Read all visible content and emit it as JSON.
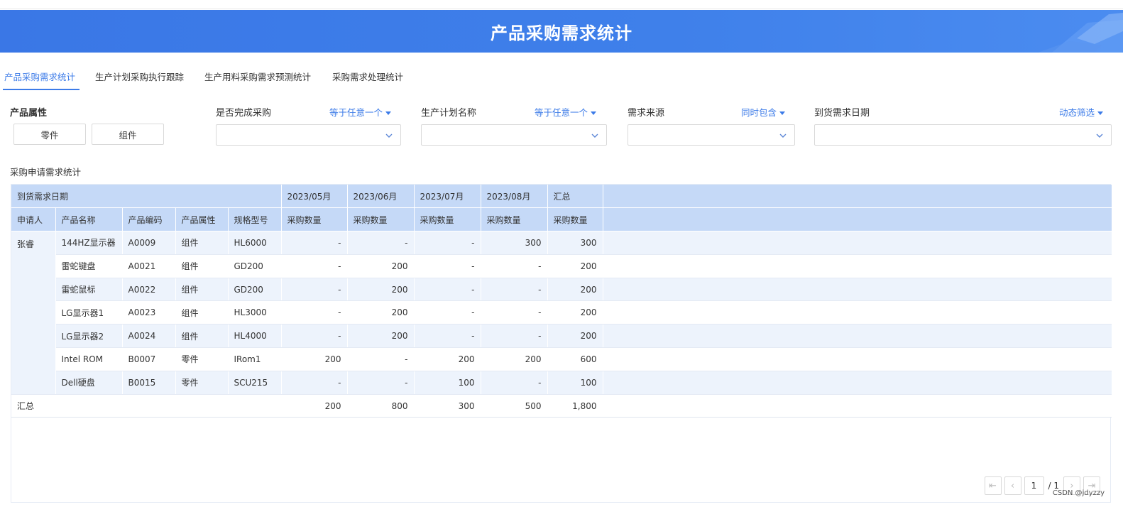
{
  "header": {
    "title": "产品采购需求统计"
  },
  "tabs": [
    {
      "label": "产品采购需求统计",
      "active": true
    },
    {
      "label": "生产计划采购执行跟踪",
      "active": false
    },
    {
      "label": "生产用料采购需求预测统计",
      "active": false
    },
    {
      "label": "采购需求处理统计",
      "active": false
    }
  ],
  "filters": {
    "product_attr": {
      "label": "产品属性",
      "options": [
        "零件",
        "组件"
      ]
    },
    "purchase_done": {
      "label": "是否完成采购",
      "operator": "等于任意一个",
      "value": ""
    },
    "plan_name": {
      "label": "生产计划名称",
      "operator": "等于任意一个",
      "value": ""
    },
    "demand_source": {
      "label": "需求来源",
      "operator": "同时包含",
      "value": ""
    },
    "arrival_date": {
      "label": "到货需求日期",
      "operator": "动态筛选",
      "value": ""
    }
  },
  "section": {
    "title": "采购申请需求统计"
  },
  "table": {
    "corner_label": "到货需求日期",
    "months": [
      "2023/05月",
      "2023/06月",
      "2023/07月",
      "2023/08月",
      "汇总"
    ],
    "columns": [
      "申请人",
      "产品名称",
      "产品编码",
      "产品属性",
      "规格型号"
    ],
    "measure": "采购数量",
    "applicant": "张睿",
    "rows": [
      {
        "name": "144HZ显示器",
        "code": "A0009",
        "attr": "组件",
        "spec": "HL6000",
        "values": [
          "-",
          "-",
          "-",
          "300",
          "300"
        ]
      },
      {
        "name": "雷蛇键盘",
        "code": "A0021",
        "attr": "组件",
        "spec": "GD200",
        "values": [
          "-",
          "200",
          "-",
          "-",
          "200"
        ]
      },
      {
        "name": "雷蛇鼠标",
        "code": "A0022",
        "attr": "组件",
        "spec": "GD200",
        "values": [
          "-",
          "200",
          "-",
          "-",
          "200"
        ]
      },
      {
        "name": "LG显示器1",
        "code": "A0023",
        "attr": "组件",
        "spec": "HL3000",
        "values": [
          "-",
          "200",
          "-",
          "-",
          "200"
        ]
      },
      {
        "name": "LG显示器2",
        "code": "A0024",
        "attr": "组件",
        "spec": "HL4000",
        "values": [
          "-",
          "200",
          "-",
          "-",
          "200"
        ]
      },
      {
        "name": "Intel ROM",
        "code": "B0007",
        "attr": "零件",
        "spec": "IRom1",
        "values": [
          "200",
          "-",
          "200",
          "200",
          "600"
        ]
      },
      {
        "name": "Dell硬盘",
        "code": "B0015",
        "attr": "零件",
        "spec": "SCU215",
        "values": [
          "-",
          "-",
          "100",
          "-",
          "100"
        ]
      }
    ],
    "total": {
      "label": "汇总",
      "values": [
        "200",
        "800",
        "300",
        "500",
        "1,800"
      ]
    }
  },
  "pagination": {
    "current": "1",
    "total": "1"
  },
  "watermark": "CSDN @jdyzzy",
  "colors": {
    "accent": "#3c7be8",
    "banner": "#3f80ea",
    "header_row": "#c5d9f7",
    "stripe": "#edf3fc"
  }
}
